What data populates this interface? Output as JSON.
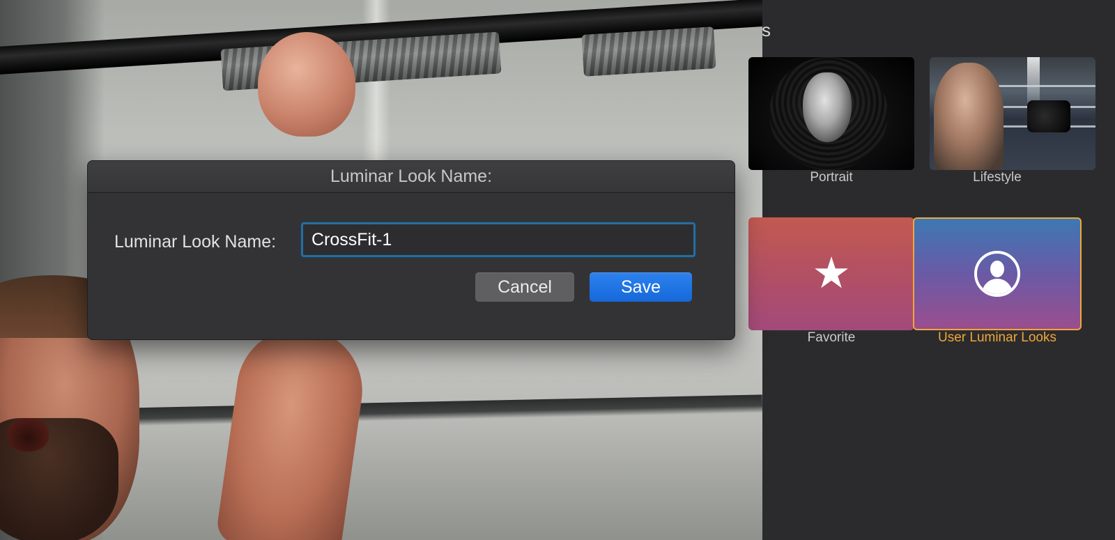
{
  "dialog": {
    "title": "Luminar Look Name:",
    "field_label": "Luminar Look Name:",
    "field_value": "CrossFit-1",
    "cancel_label": "Cancel",
    "save_label": "Save"
  },
  "panel": {
    "title_fragment": "s",
    "categories": [
      {
        "label": "Portrait",
        "icon": "portrait-photo"
      },
      {
        "label": "Lifestyle",
        "icon": "lifestyle-photo"
      },
      {
        "label": "Favorite",
        "icon": "star-icon"
      },
      {
        "label": "User Luminar Looks",
        "icon": "user-icon",
        "selected": true
      }
    ]
  },
  "colors": {
    "accent_selected": "#f0a73a",
    "save_button": "#1a6fe0",
    "input_focus": "#2b6c9b",
    "panel_background": "#2b2b2d"
  }
}
